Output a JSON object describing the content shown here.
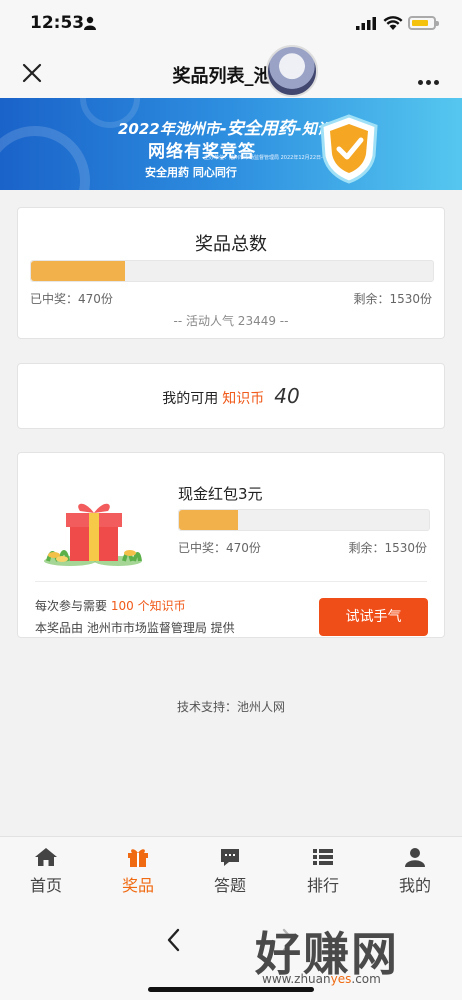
{
  "status": {
    "time": "12:53"
  },
  "nav": {
    "title": "奖品列表_池州"
  },
  "banner": {
    "line1_prefix": "2022年池州市",
    "line1_highlight": "-安全用药-",
    "line1_suffix": "知识",
    "line2": "网络有奖竞答",
    "line3": "安全用药 同心同行",
    "small_note": "主办单位：池州市市场监督管理局 2022年12月22日-12月25日"
  },
  "summary": {
    "heading": "奖品总数",
    "won_label": "已中奖：470份",
    "remaining_label": "剩余：1530份",
    "progress": 0.235,
    "popularity": "-- 活动人气  23449 --"
  },
  "coins": {
    "prefix": "我的可用",
    "coin_label": "知识币",
    "amount": "40"
  },
  "prize": {
    "name": "现金红包3元",
    "won_label": "已中奖：470份",
    "remaining_label": "剩余：1530份",
    "progress": 0.235,
    "requirement_prefix": "每次参与需要",
    "requirement_value": "100 个知识币",
    "provider": "本奖品由 池州市市场监督管理局 提供",
    "button": "试试手气"
  },
  "footer": {
    "support": "技术支持：池州人网"
  },
  "tabs": [
    {
      "label": "首页",
      "icon": "home-icon"
    },
    {
      "label": "奖品",
      "icon": "gift-icon",
      "active": true
    },
    {
      "label": "答题",
      "icon": "chat-icon"
    },
    {
      "label": "排行",
      "icon": "list-icon"
    },
    {
      "label": "我的",
      "icon": "person-icon"
    }
  ],
  "watermark": {
    "text": "好赚网",
    "url_pre": "www.zhuan",
    "url_hl": "yes",
    "url_post": ".com"
  },
  "colors": {
    "accent": "#f05a1a",
    "progress": "#f2b14a",
    "banner_start": "#1a63c9",
    "banner_end": "#55c7ef"
  }
}
